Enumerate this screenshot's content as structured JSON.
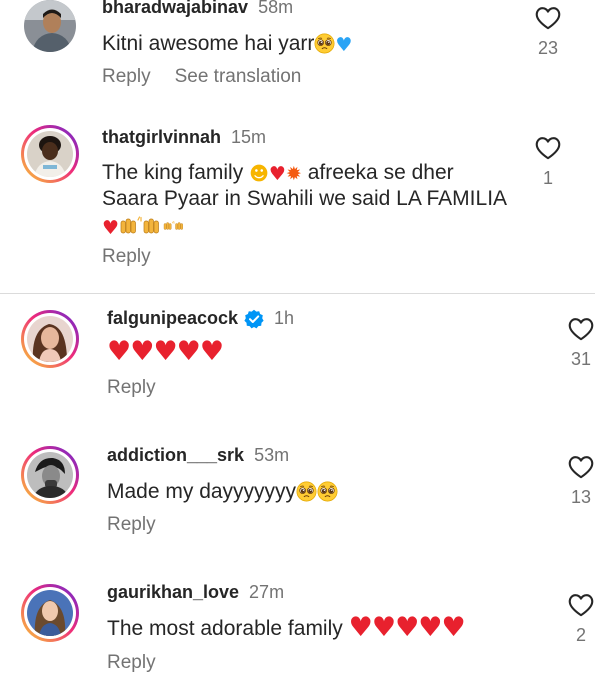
{
  "comments": [
    {
      "username": "bharadwajabinav",
      "time": "58m",
      "text": "Kitni awesome hai yarr",
      "likes": "23",
      "reply_label": "Reply",
      "translate_label": "See translation",
      "verified": false,
      "icons": [
        "pleading-face-icon",
        "blue-heart-icon"
      ]
    },
    {
      "username": "thatgirlvinnah",
      "time": "15m",
      "text_line1": "The king family",
      "text_line1b": "afreeka se dher",
      "text_line2": "Saara Pyaar in Swahili we said LA FAMILIA",
      "likes": "1",
      "reply_label": "Reply",
      "verified": false,
      "icons": [
        "heart-eyes-icon",
        "red-heart-icon",
        "fire-icon",
        "raising-hands-icon"
      ]
    },
    {
      "username": "falgunipeacock",
      "time": "1h",
      "text": "",
      "likes": "31",
      "reply_label": "Reply",
      "verified": true,
      "icons": [
        "red-heart-icon"
      ]
    },
    {
      "username": "addiction___srk",
      "time": "53m",
      "text": "Made my dayyyyyyy",
      "likes": "13",
      "reply_label": "Reply",
      "verified": false,
      "icons": [
        "pleading-face-icon"
      ]
    },
    {
      "username": "gaurikhan_love",
      "time": "27m",
      "text": "The most adorable family",
      "likes": "2",
      "reply_label": "Reply",
      "verified": false,
      "icons": [
        "red-heart-icon"
      ]
    }
  ],
  "colors": {
    "text": "#262626",
    "muted": "#737373",
    "divider": "#dbdbdb",
    "verified_badge": "#0095f6",
    "heart_red": "#e8212e",
    "heart_blue": "#2aa4f5",
    "story_ring_start": "#f9ce34",
    "story_ring_mid": "#ee2a7b",
    "story_ring_end": "#6228d7"
  }
}
